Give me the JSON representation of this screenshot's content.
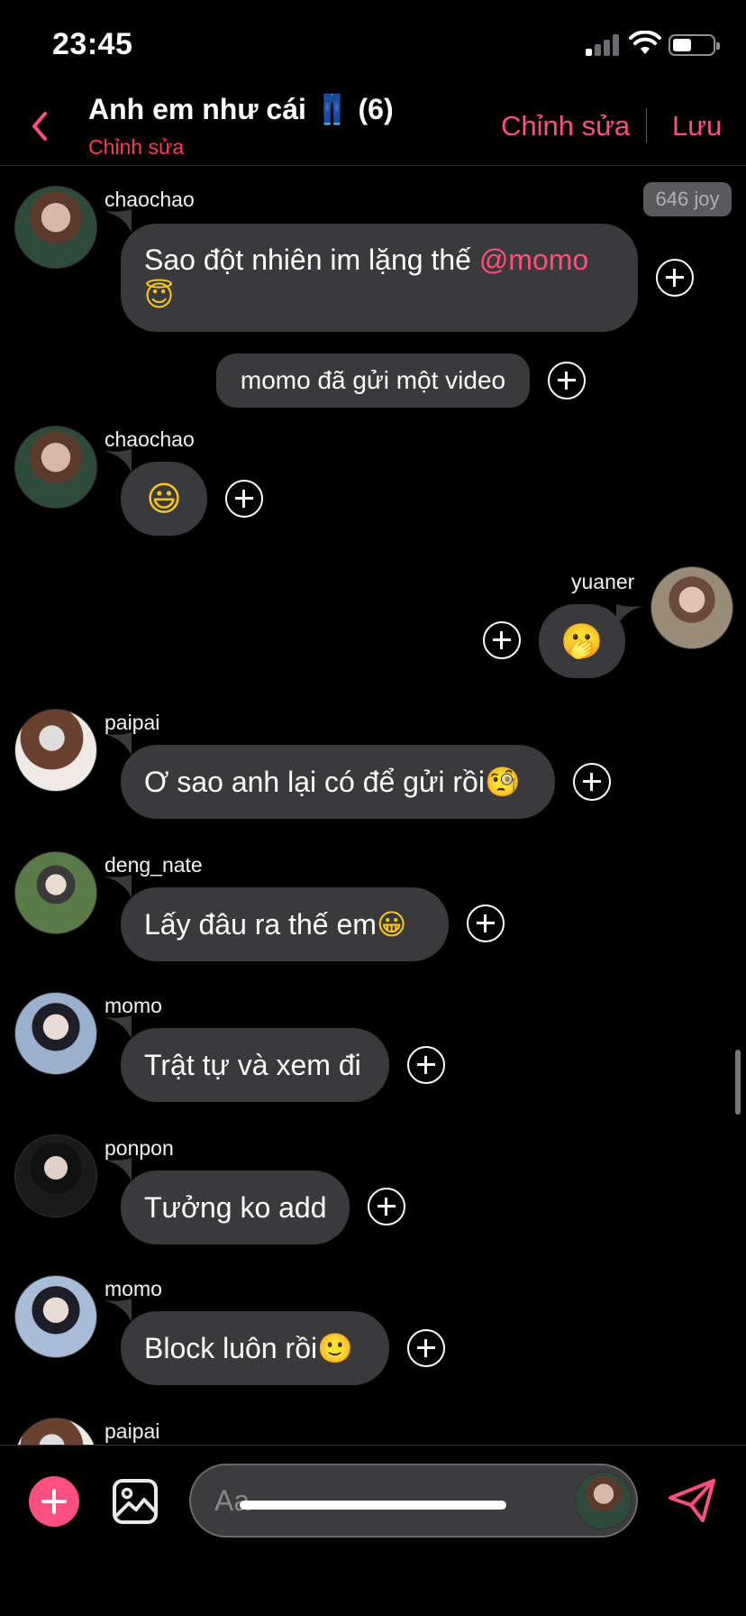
{
  "status_bar": {
    "time": "23:45"
  },
  "header": {
    "title": "Anh em như cái 👖 (6)",
    "subtitle": "Chỉnh sửa",
    "edit_label": "Chỉnh sửa",
    "save_label": "Lưu"
  },
  "joy_badge": "646 joy",
  "messages": [
    {
      "user": "chaochao",
      "text": "Sao đột nhiên im lặng thế ",
      "mention": "@momo",
      "emoji": "😇"
    },
    {
      "system": "momo đã gửi một video"
    },
    {
      "user": "chaochao",
      "emoji": "😃"
    },
    {
      "user": "yuaner",
      "emoji": "🫢"
    },
    {
      "user": "paipai",
      "text": "Ơ sao anh lại có để gửi rồi",
      "emoji": "🧐"
    },
    {
      "user": "deng_nate",
      "text": "Lấy đâu ra thế em",
      "emoji": "😀"
    },
    {
      "user": "momo",
      "text": "Trật tự và xem đi"
    },
    {
      "user": "ponpon",
      "text": "Tưởng ko add"
    },
    {
      "user": "momo",
      "text": "Block luôn rồi",
      "emoji": "🙂"
    },
    {
      "user": "paipai"
    }
  ],
  "composer": {
    "placeholder": "Aa"
  },
  "icons": {
    "back": "chevron-left-icon",
    "add": "plus-circle-icon",
    "image": "image-icon",
    "send": "send-icon",
    "reaction": "add-reaction-icon"
  },
  "colors": {
    "accent": "#ff4f7e",
    "bubble": "#3a3a3c",
    "background": "#000000",
    "subtitle": "#ff3b4e"
  }
}
